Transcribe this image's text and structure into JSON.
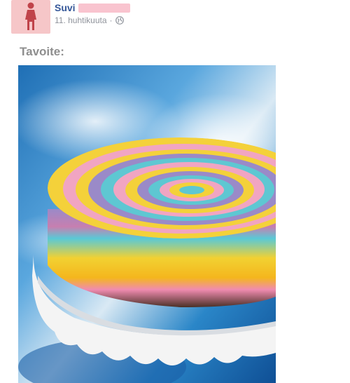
{
  "post": {
    "author_name": "Suvi",
    "timestamp": "11. huhtikuuta",
    "separator": "·",
    "privacy_icon": "globe-icon",
    "text": "Tavoite:"
  },
  "avatar": {
    "icon": "female-silhouette-icon",
    "color": "#c0434a",
    "bg": "#f6c6c8"
  },
  "photo": {
    "subject": "rainbow-cheesecake"
  }
}
